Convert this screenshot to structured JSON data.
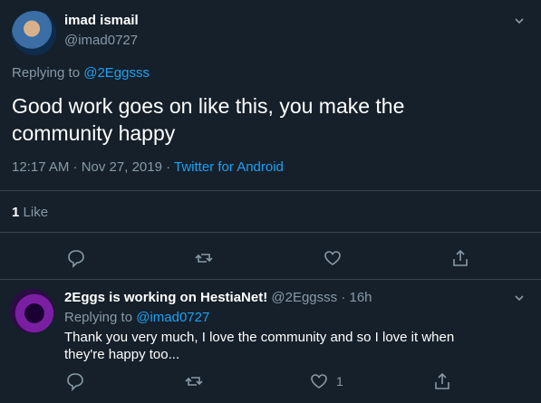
{
  "tweet": {
    "author_name": "imad ismail",
    "author_handle": "@imad0727",
    "replying_prefix": "Replying to",
    "replying_handle": "@2Eggsss",
    "text_line1": "Good work goes on like this, you make the",
    "text_line2": "community happy",
    "time_date": "12:17 AM · Nov 27, 2019 ·",
    "source": "Twitter for Android",
    "likes_count": "1",
    "likes_label": "Like"
  },
  "reply": {
    "author_name": "2Eggs is working on HestiaNet!",
    "author_handle": "@2Eggsss",
    "age": "· 16h",
    "replying_prefix": "Replying to",
    "replying_handle": "@imad0727",
    "text_line1": "Thank you very much, I love the community and so I love it when",
    "text_line2": "they're happy too...",
    "like_count": "1"
  },
  "colors": {
    "background": "#15202b",
    "accent": "#1da1f2",
    "muted": "#8899a6",
    "divider": "#38444d"
  },
  "icons": [
    "chevron-down-icon",
    "reply-icon",
    "retweet-icon",
    "like-icon",
    "share-icon"
  ]
}
